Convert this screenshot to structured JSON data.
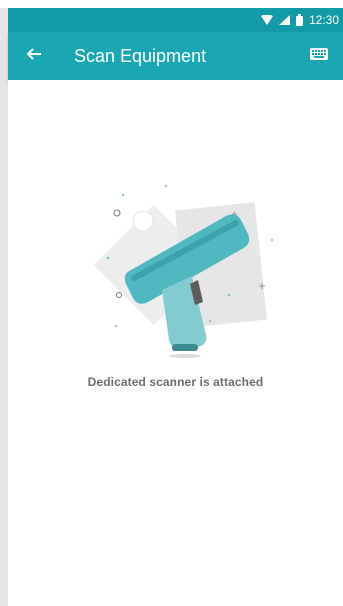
{
  "status_bar": {
    "time": "12:30"
  },
  "app_bar": {
    "title": "Scan Equipment"
  },
  "content": {
    "message": "Dedicated scanner is attached"
  },
  "colors": {
    "primary": "#1aa7b3",
    "status": "#139ba8",
    "scanner": "#5bc0c6"
  },
  "icons": {
    "back": "arrow-left-icon",
    "keyboard": "keyboard-icon",
    "wifi": "wifi-icon",
    "signal": "signal-icon",
    "battery": "battery-icon",
    "illustration": "barcode-scanner-icon"
  }
}
